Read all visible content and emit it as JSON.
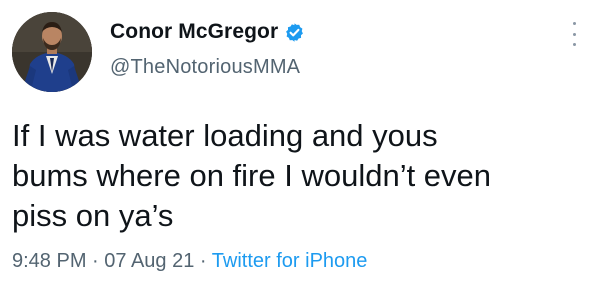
{
  "tweet": {
    "author": {
      "display_name": "Conor McGregor",
      "handle": "@TheNotoriousMMA",
      "verified": true,
      "avatar_icon": "profile-photo"
    },
    "text": "If I was water loading and yous\nbums where on fire I wouldn’t even\npiss on ya’s",
    "meta": {
      "time": "9:48 PM",
      "separator": "·",
      "date": "07 Aug 21",
      "source": "Twitter for iPhone"
    },
    "more_icon": "more-options-icon"
  },
  "colors": {
    "verified_badge": "#1d9bf0",
    "secondary_text": "#536471",
    "link": "#1d9bf0",
    "primary_text": "#0f1419"
  }
}
